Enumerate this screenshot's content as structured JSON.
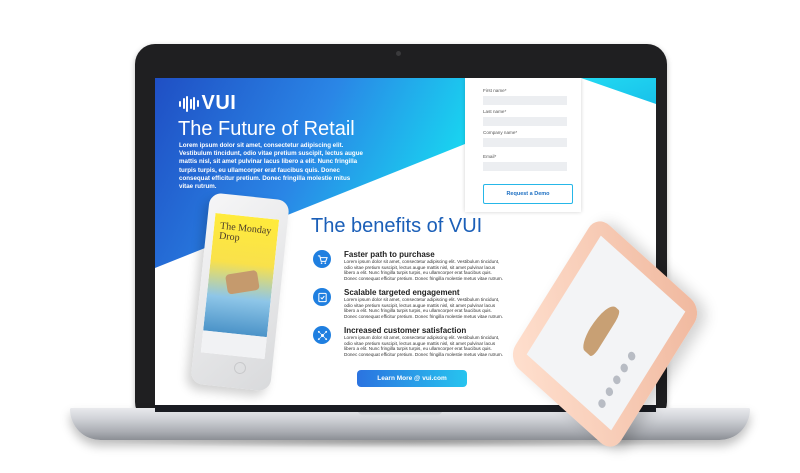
{
  "hero": {
    "logo": "VUI",
    "title": "The Future of Retail",
    "intro": "Lorem ipsum dolor sit amet, consectetur adipiscing elit. Vestibulum tincidunt, odio vitae pretium suscipit, lectus augue mattis nisl, sit amet pulvinar lacus libero a elit. Nunc fringilla turpis turpis, eu ullamcorper erat faucibus quis. Donec consequat efficitur pretium. Donec fringilla molestie mitus vitae rutrum."
  },
  "form": {
    "first_name_label": "First name*",
    "last_name_label": "Last name*",
    "company_label": "Company name*",
    "email_label": "Email*",
    "submit_label": "Request a Demo"
  },
  "benefits": {
    "title": "The benefits of VUI",
    "items": [
      {
        "heading": "Faster path to purchase",
        "text": "Lorem ipsum dolor sit amet, consectetur adipiscing elit. Vestibulum tincidunt, odio vitae pretium suscipit, lectus augue mattis nisl, sit amet pulvinar lacus libero a elit. Nunc fringilla turpis turpis, eu ullamcorper erat faucibus quis. Donec consequat efficitur pretium. Donec fringilla molestie metus vitae rutrum.",
        "icon": "cart-icon"
      },
      {
        "heading": "Scalable targeted engagement",
        "text": "Lorem ipsum dolor sit amet, consectetur adipiscing elit. Vestibulum tincidunt, odio vitae pretium suscipit, lectus augue mattis nisl, sit amet pulvinar lacus libero a elit. Nunc fringilla turpis turpis, eu ullamcorper erat faucibus quis. Donec consequat efficitur pretium. Donec fringilla molestie metus vitae rutrum.",
        "icon": "checklist-icon"
      },
      {
        "heading": "Increased customer satisfaction",
        "text": "Lorem ipsum dolor sit amet, consectetur adipiscing elit. Vestibulum tincidunt, odio vitae pretium suscipit, lectus augue mattis nisl, sit amet pulvinar lacus libero a elit. Nunc fringilla turpis turpis, eu ullamcorper erat faucibus quis. Donec consequat efficitur pretium. Donec fringilla molestie metus vitae rutrum.",
        "icon": "network-icon"
      }
    ]
  },
  "cta": {
    "label": "Learn More @ vui.com"
  },
  "phone_left": {
    "magazine_title": "The Monday Drop"
  },
  "colors": {
    "hero_gradient_start": "#1f4fc4",
    "hero_gradient_end": "#19d3f0",
    "accent_blue": "#1b5fb8",
    "icon_blue": "#1f7fe0",
    "button_gradient_start": "#2b73e0",
    "button_gradient_end": "#27c4ef"
  }
}
